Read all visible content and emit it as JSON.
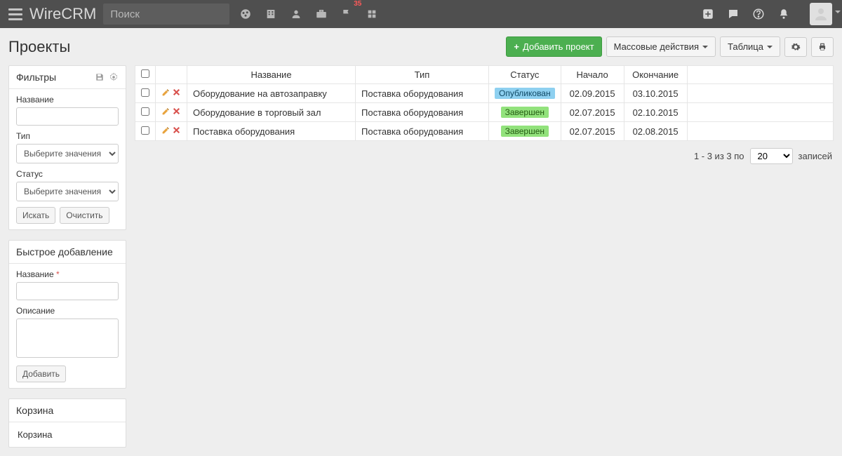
{
  "app": {
    "brand": "WireCRM",
    "search_placeholder": "Поиск",
    "flag_count": "35"
  },
  "page": {
    "title": "Проекты"
  },
  "actions": {
    "add_project": "Добавить проект",
    "bulk": "Массовые действия",
    "view": "Таблица"
  },
  "filters_panel": {
    "title": "Фильтры",
    "name_label": "Название",
    "type_label": "Тип",
    "status_label": "Статус",
    "select_placeholder": "Выберите значения",
    "search_btn": "Искать",
    "clear_btn": "Очистить"
  },
  "quickadd_panel": {
    "title": "Быстрое добавление",
    "name_label": "Название",
    "desc_label": "Описание",
    "add_btn": "Добавить"
  },
  "trash_panel": {
    "title": "Корзина",
    "link": "Корзина"
  },
  "table": {
    "headers": {
      "name": "Название",
      "type": "Тип",
      "status": "Статус",
      "start": "Начало",
      "end": "Окончание"
    },
    "rows": [
      {
        "name": "Оборудование на автозаправку",
        "type": "Поставка оборудования",
        "status": "Опубликован",
        "status_kind": "blue",
        "start": "02.09.2015",
        "end": "03.10.2015"
      },
      {
        "name": "Оборудование в торговый зал",
        "type": "Поставка оборудования",
        "status": "Завершен",
        "status_kind": "green",
        "start": "02.07.2015",
        "end": "02.10.2015"
      },
      {
        "name": "Поставка оборудования",
        "type": "Поставка оборудования",
        "status": "Завершен",
        "status_kind": "green",
        "start": "02.07.2015",
        "end": "02.08.2015"
      }
    ]
  },
  "pager": {
    "summary": "1 - 3 из 3 по",
    "page_size": "20",
    "suffix": "записей"
  }
}
